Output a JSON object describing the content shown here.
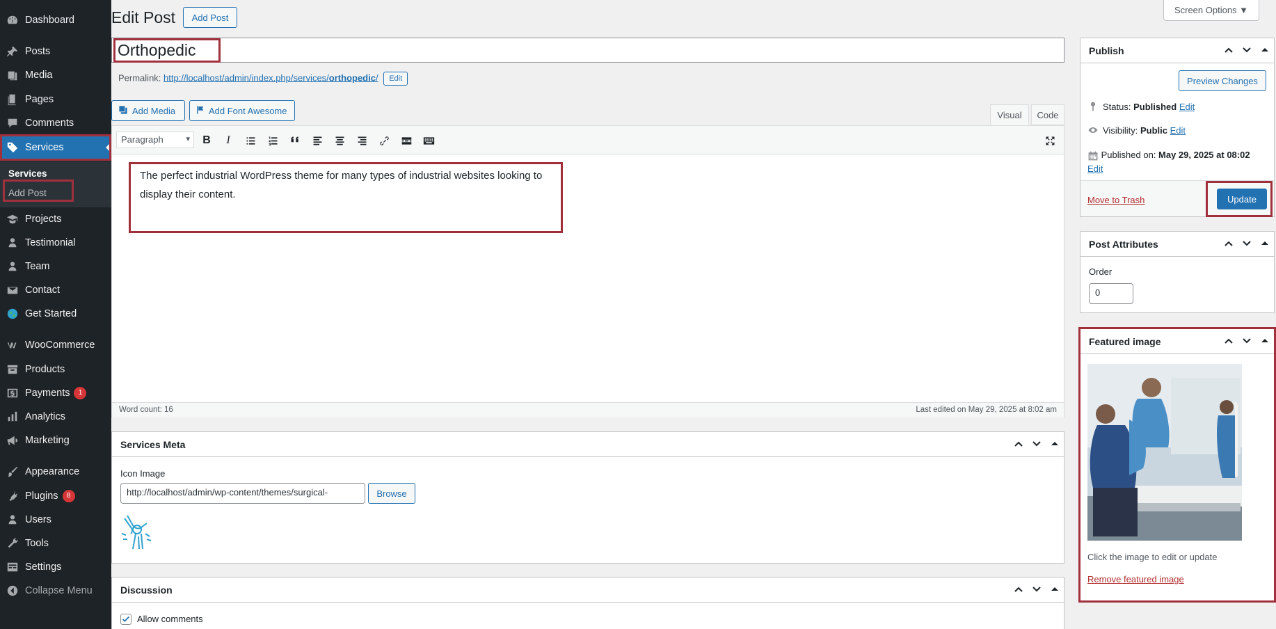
{
  "sidebar": {
    "items": [
      {
        "label": "Dashboard",
        "icon": "dashboard-icon"
      },
      {
        "label": "Posts",
        "icon": "pin-icon"
      },
      {
        "label": "Media",
        "icon": "media-icon"
      },
      {
        "label": "Pages",
        "icon": "pages-icon"
      },
      {
        "label": "Comments",
        "icon": "comments-icon"
      },
      {
        "label": "Services",
        "icon": "tag-icon"
      },
      {
        "label": "Projects",
        "icon": "portfolio-icon"
      },
      {
        "label": "Testimonial",
        "icon": "user-icon"
      },
      {
        "label": "Team",
        "icon": "user-icon"
      },
      {
        "label": "Contact",
        "icon": "mail-icon"
      },
      {
        "label": "Get Started",
        "icon": "globe-icon"
      },
      {
        "label": "WooCommerce",
        "icon": "woo-icon"
      },
      {
        "label": "Products",
        "icon": "archive-icon"
      },
      {
        "label": "Payments",
        "icon": "payments-icon",
        "badge": "1"
      },
      {
        "label": "Analytics",
        "icon": "chart-icon"
      },
      {
        "label": "Marketing",
        "icon": "megaphone-icon"
      },
      {
        "label": "Appearance",
        "icon": "brush-icon"
      },
      {
        "label": "Plugins",
        "icon": "plugin-icon",
        "badge": "8"
      },
      {
        "label": "Users",
        "icon": "users-icon"
      },
      {
        "label": "Tools",
        "icon": "wrench-icon"
      },
      {
        "label": "Settings",
        "icon": "settings-icon"
      },
      {
        "label": "Collapse Menu",
        "icon": "collapse-icon"
      }
    ],
    "submenu": {
      "title": "Services",
      "add": "Add Post"
    }
  },
  "header": {
    "title": "Edit Post",
    "add_post": "Add Post",
    "screen_options": "Screen Options ▼"
  },
  "post": {
    "title": "Orthopedic",
    "permalink_label": "Permalink:",
    "permalink_base": "http://localhost/admin/index.php/services/",
    "permalink_slug": "orthopedic",
    "permalink_end": "/",
    "permalink_edit": "Edit"
  },
  "editor": {
    "add_media": "Add Media",
    "add_font_awesome": "Add Font Awesome",
    "tab_visual": "Visual",
    "tab_code": "Code",
    "format": "Paragraph",
    "content": "The perfect industrial WordPress theme for many types of industrial websites looking to display their content.",
    "word_count": "Word count: 16",
    "last_edited": "Last edited on May 29, 2025 at 8:02 am"
  },
  "services_meta": {
    "title": "Services Meta",
    "icon_label": "Icon Image",
    "icon_value": "http://localhost/admin/wp-content/themes/surgical-",
    "browse": "Browse"
  },
  "discussion": {
    "title": "Discussion",
    "allow_comments": "Allow comments"
  },
  "publish": {
    "title": "Publish",
    "preview": "Preview Changes",
    "status_label": "Status:",
    "status_value": "Published",
    "visibility_label": "Visibility:",
    "visibility_value": "Public",
    "published_label": "Published on:",
    "published_value": "May 29, 2025 at 08:02",
    "edit": "Edit",
    "trash": "Move to Trash",
    "update": "Update"
  },
  "attributes": {
    "title": "Post Attributes",
    "order_label": "Order",
    "order_value": "0"
  },
  "featured": {
    "title": "Featured image",
    "hint": "Click the image to edit or update",
    "remove": "Remove featured image"
  },
  "colors": {
    "sidebar_bg": "#1d2327",
    "accent": "#2271b1",
    "highlight_box": "#a1303d",
    "danger": "#b32d2e"
  }
}
